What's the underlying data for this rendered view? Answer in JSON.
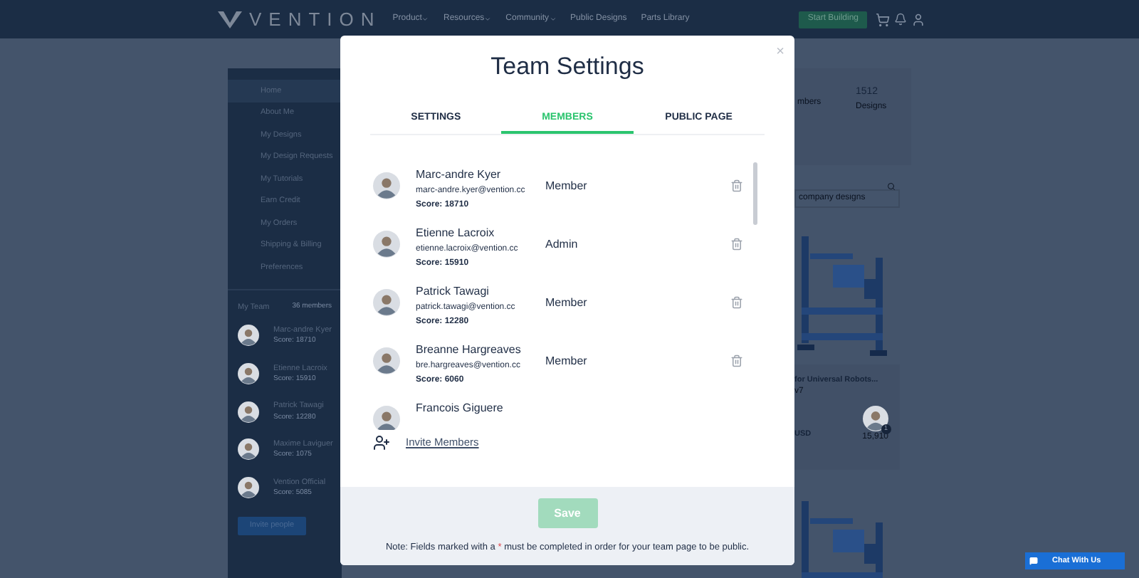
{
  "nav": {
    "logo": "VENTION",
    "links": [
      "Product",
      "Resources",
      "Community",
      "Public Designs",
      "Parts Library"
    ],
    "dropdowns": [
      true,
      true,
      true,
      false,
      false
    ],
    "cta": "Start Building"
  },
  "sidebar": {
    "items": [
      {
        "label": "Home",
        "selected": true
      },
      {
        "label": "About Me",
        "selected": false
      },
      {
        "label": "My Designs",
        "selected": false
      },
      {
        "label": "My Design Requests",
        "selected": false
      },
      {
        "label": "My Tutorials",
        "selected": false
      },
      {
        "label": "Earn Credit",
        "selected": false
      },
      {
        "label": "My Orders",
        "selected": false
      },
      {
        "label": "Shipping & Billing",
        "selected": false
      },
      {
        "label": "Preferences",
        "selected": false
      }
    ],
    "team_title": "My Team",
    "team_count": "36 members",
    "team": [
      {
        "name": "Marc-andre Kyer",
        "score": "Score: 18710"
      },
      {
        "name": "Etienne Lacroix",
        "score": "Score: 15910"
      },
      {
        "name": "Patrick Tawagi",
        "score": "Score: 12280"
      },
      {
        "name": "Maxime Laviguer",
        "score": "Score: 1075"
      },
      {
        "name": "Vention Official",
        "score": "Score: 5085"
      }
    ],
    "invite": "Invite people"
  },
  "stats": [
    {
      "label": "mbers"
    },
    {
      "value": "1512",
      "label": "Designs"
    }
  ],
  "search": {
    "placeholder": "company designs"
  },
  "card": {
    "title": "for Universal Robots...",
    "version": "v7",
    "price": "USD",
    "badge": "1",
    "score": "15,910"
  },
  "modal": {
    "title": "Team Settings",
    "close": "×",
    "tabs": [
      {
        "label": "SETTINGS",
        "selected": false
      },
      {
        "label": "MEMBERS",
        "selected": true
      },
      {
        "label": "PUBLIC PAGE",
        "selected": false
      }
    ],
    "members": [
      {
        "name": "Marc-andre Kyer",
        "email": "marc-andre.kyer@vention.cc",
        "score": "Score: 18710",
        "role": "Member"
      },
      {
        "name": "Etienne Lacroix",
        "email": "etienne.lacroix@vention.cc",
        "score": "Score: 15910",
        "role": "Admin"
      },
      {
        "name": "Patrick Tawagi",
        "email": "patrick.tawagi@vention.cc",
        "score": "Score: 12280",
        "role": "Member"
      },
      {
        "name": "Breanne Hargreaves",
        "email": "bre.hargreaves@vention.cc",
        "score": "Score: 6060",
        "role": "Member"
      },
      {
        "name": "Francois Giguere"
      }
    ],
    "invite": "Invite Members",
    "save": {
      "label": "Save",
      "disabled": true
    },
    "note_before": "Note: Fields marked with a",
    "required_mark": "*",
    "note_after": "must be completed in order for your team page to be public."
  },
  "chat": "Chat With Us"
}
